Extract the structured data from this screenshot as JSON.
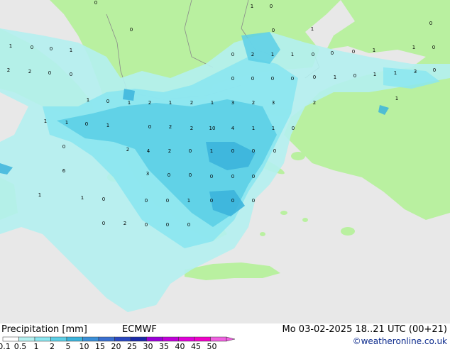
{
  "footer": {
    "title": "Precipitation [mm]",
    "model": "ECMWF",
    "datetime": "Mo 03-02-2025 18..21 UTC (00+21)",
    "credit": "©weatheronline.co.uk"
  },
  "legend": {
    "labels": [
      "0.1",
      "0.5",
      "1",
      "2",
      "5",
      "10",
      "15",
      "20",
      "25",
      "30",
      "35",
      "40",
      "45",
      "50"
    ],
    "colors": [
      "#ffffff",
      "#b4f0f0",
      "#8be6f0",
      "#5ccfe6",
      "#3cb4dc",
      "#3a8fd8",
      "#3a6fd0",
      "#2a48c0",
      "#1a2aa8",
      "#9a00d8",
      "#c000d8",
      "#e000d8",
      "#f000c8",
      "#f060e0"
    ]
  },
  "colors": {
    "sea": "#e8e8e8",
    "land": "#b9f0a0",
    "precip_light": "#b4f0f0",
    "precip_medium": "#8be6f0",
    "precip_heavy": "#5ccfe6",
    "precip_strong": "#3cb4dc"
  },
  "map_values": [
    "0",
    "1",
    "0",
    "0",
    "1",
    "0",
    "0",
    "1",
    "0",
    "0",
    "1",
    "0",
    "2",
    "1",
    "1",
    "0",
    "0",
    "0",
    "1",
    "1",
    "0",
    "2",
    "2",
    "0",
    "0",
    "0",
    "0",
    "0",
    "0",
    "0",
    "1",
    "0",
    "1",
    "1",
    "3",
    "0",
    "1",
    "0",
    "1",
    "2",
    "1",
    "2",
    "1",
    "3",
    "2",
    "3",
    "2",
    "1",
    "1",
    "1",
    "0",
    "1",
    "0",
    "2",
    "2",
    "10",
    "4",
    "1",
    "1",
    "0",
    "0",
    "2",
    "4",
    "2",
    "0",
    "1",
    "0",
    "0",
    "0",
    "6",
    "3",
    "0",
    "0",
    "0",
    "0",
    "0",
    "1",
    "1",
    "0",
    "0",
    "0",
    "1",
    "0",
    "0",
    "0",
    "0",
    "2",
    "0",
    "0",
    "0",
    "0",
    "0",
    "0",
    "0"
  ]
}
